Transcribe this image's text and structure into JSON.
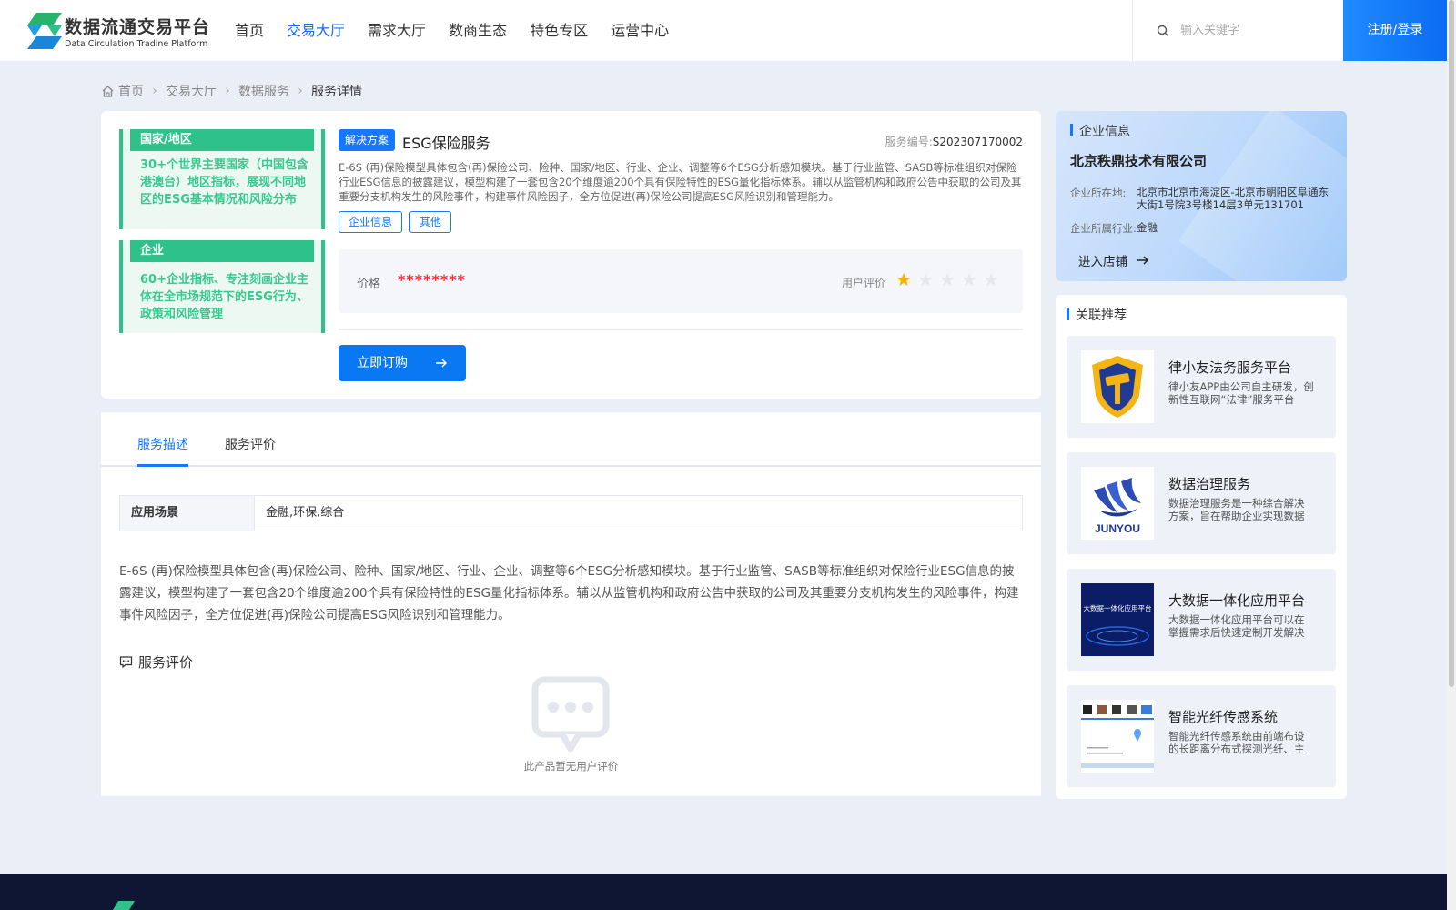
{
  "header": {
    "logo_title": "数据流通交易平台",
    "logo_subtitle": "Data Circulation Tradine Platform",
    "nav": [
      "首页",
      "交易大厅",
      "需求大厅",
      "数商生态",
      "特色专区",
      "运营中心"
    ],
    "active_nav": "交易大厅",
    "search_placeholder": "输入关键字",
    "login_label": "注册/登录"
  },
  "breadcrumb": [
    "首页",
    "交易大厅",
    "数据服务",
    "服务详情"
  ],
  "product": {
    "thumb": {
      "block1_title": "国家/地区",
      "block1_text": "30+个世界主要国家（中国包含港澳台）地区指标，展现不同地区的ESG基本情况和风险分布",
      "block2_title": "企业",
      "block2_text": "60+企业指标、专注刻画企业主体在全市场规范下的ESG行为、政策和风险管理"
    },
    "type_tag": "解决方案",
    "title": "ESG保险服务",
    "service_no_label": "服务编号:",
    "service_no": "S202307170002",
    "description": "E-6S (再)保险模型具体包含(再)保险公司、险种、国家/地区、行业、企业、调整等6个ESG分析感知模块。基于行业监管、SASB等标准组织对保险行业ESG信息的披露建议，模型构建了一套包含20个维度逾200个具有保险特性的ESG量化指标体系。辅以从监管机构和政府公告中获取的公司及其重要分支机构发生的风险事件，构建事件风险因子，全方位促进(再)保险公司提高ESG风险识别和管理能力。",
    "tags": [
      "企业信息",
      "其他"
    ],
    "price_label": "价格",
    "price_value": "********",
    "rating_label": "用户评价",
    "rating": 1,
    "rating_max": 5,
    "buy_label": "立即订购"
  },
  "detail": {
    "tabs": [
      "服务描述",
      "服务评价"
    ],
    "active_tab": "服务描述",
    "scene_key": "应用场景",
    "scene_value": "金融,环保,综合",
    "long_description": "E-6S (再)保险模型具体包含(再)保险公司、险种、国家/地区、行业、企业、调整等6个ESG分析感知模块。基于行业监管、SASB等标准组织对保险行业ESG信息的披露建议，模型构建了一套包含20个维度逾200个具有保险特性的ESG量化指标体系。辅以从监管机构和政府公告中获取的公司及其重要分支机构发生的风险事件，构建事件风险因子，全方位促进(再)保险公司提高ESG风险识别和管理能力。",
    "review_title": "服务评价",
    "empty_text": "此产品暂无用户评价"
  },
  "company": {
    "section_title": "企业信息",
    "name": "北京秩鼎技术有限公司",
    "location_label": "企业所在地:",
    "location": "北京市北京市海淀区-北京市朝阳区阜通东大街1号院3号楼14层3单元131701",
    "industry_label": "企业所属行业:",
    "industry": "金融",
    "shop_label": "进入店铺"
  },
  "recommend": {
    "section_title": "关联推荐",
    "items": [
      {
        "name": "律小友法务服务平台",
        "desc": "律小友APP由公司自主研发，创新性互联网“法律”服务平台",
        "logo": "shield-hammer"
      },
      {
        "name": "数据治理服务",
        "desc": "数据治理服务是一种综合解决方案，旨在帮助企业实现数据价值",
        "logo_text": "JUNYOU"
      },
      {
        "name": "大数据一体化应用平台",
        "desc": "大数据一体化应用平台可以在掌握需求后快速定制开发解决方案",
        "img_text": "大数据一体化应用平台"
      },
      {
        "name": "智能光纤传感系统",
        "desc": "智能光纤传感系统由前端布设的长距离分布式探测光纤、主机等组成",
        "logo": "fiber-map"
      }
    ]
  },
  "colors": {
    "primary": "#1677ff",
    "accent_green": "#2ec28a",
    "price_red": "#f0323c",
    "star_gold": "#f5b400",
    "footer": "#0e1633"
  }
}
